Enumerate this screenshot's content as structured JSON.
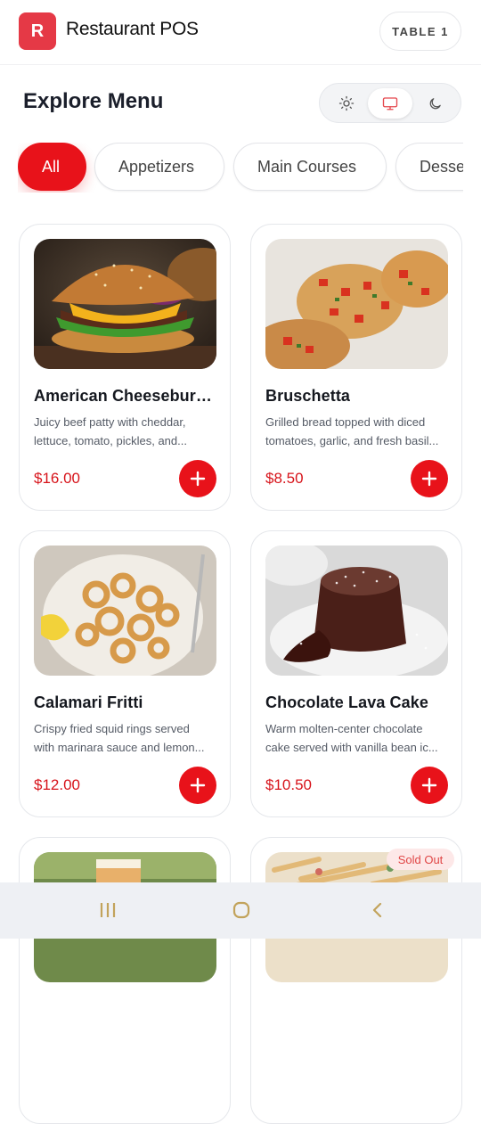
{
  "app": {
    "logo_letter": "R",
    "title": "Restaurant POS",
    "table_label": "TABLE 1"
  },
  "page": {
    "title": "Explore Menu"
  },
  "theme": {
    "options": [
      "light",
      "system",
      "dark"
    ],
    "selected": "system"
  },
  "categories": {
    "items": [
      "All",
      "Appetizers",
      "Main Courses",
      "Desserts"
    ],
    "selected": "All"
  },
  "menu": {
    "items": [
      {
        "name": "American Cheeseburger",
        "desc1": "Juicy beef patty with cheddar,",
        "desc2": "lettuce, tomato, pickles, and...",
        "price": "$16.00"
      },
      {
        "name": "Bruschetta",
        "desc1": "Grilled bread topped with diced",
        "desc2": "tomatoes, garlic, and fresh basil...",
        "price": "$8.50"
      },
      {
        "name": "Calamari Fritti",
        "desc1": "Crispy fried squid rings served",
        "desc2": "with marinara sauce and lemon...",
        "price": "$12.00"
      },
      {
        "name": "Chocolate Lava Cake",
        "desc1": "Warm molten-center chocolate",
        "desc2": "cake served with vanilla bean ic...",
        "price": "$10.50"
      },
      {
        "name": "",
        "badge": ""
      },
      {
        "name": "",
        "badge": "Sold Out"
      }
    ]
  },
  "colors": {
    "accent": "#e8121a",
    "logo": "#e53946",
    "price": "#d7141b"
  },
  "navbar": {
    "buttons": [
      "recent-apps",
      "home",
      "back"
    ]
  }
}
